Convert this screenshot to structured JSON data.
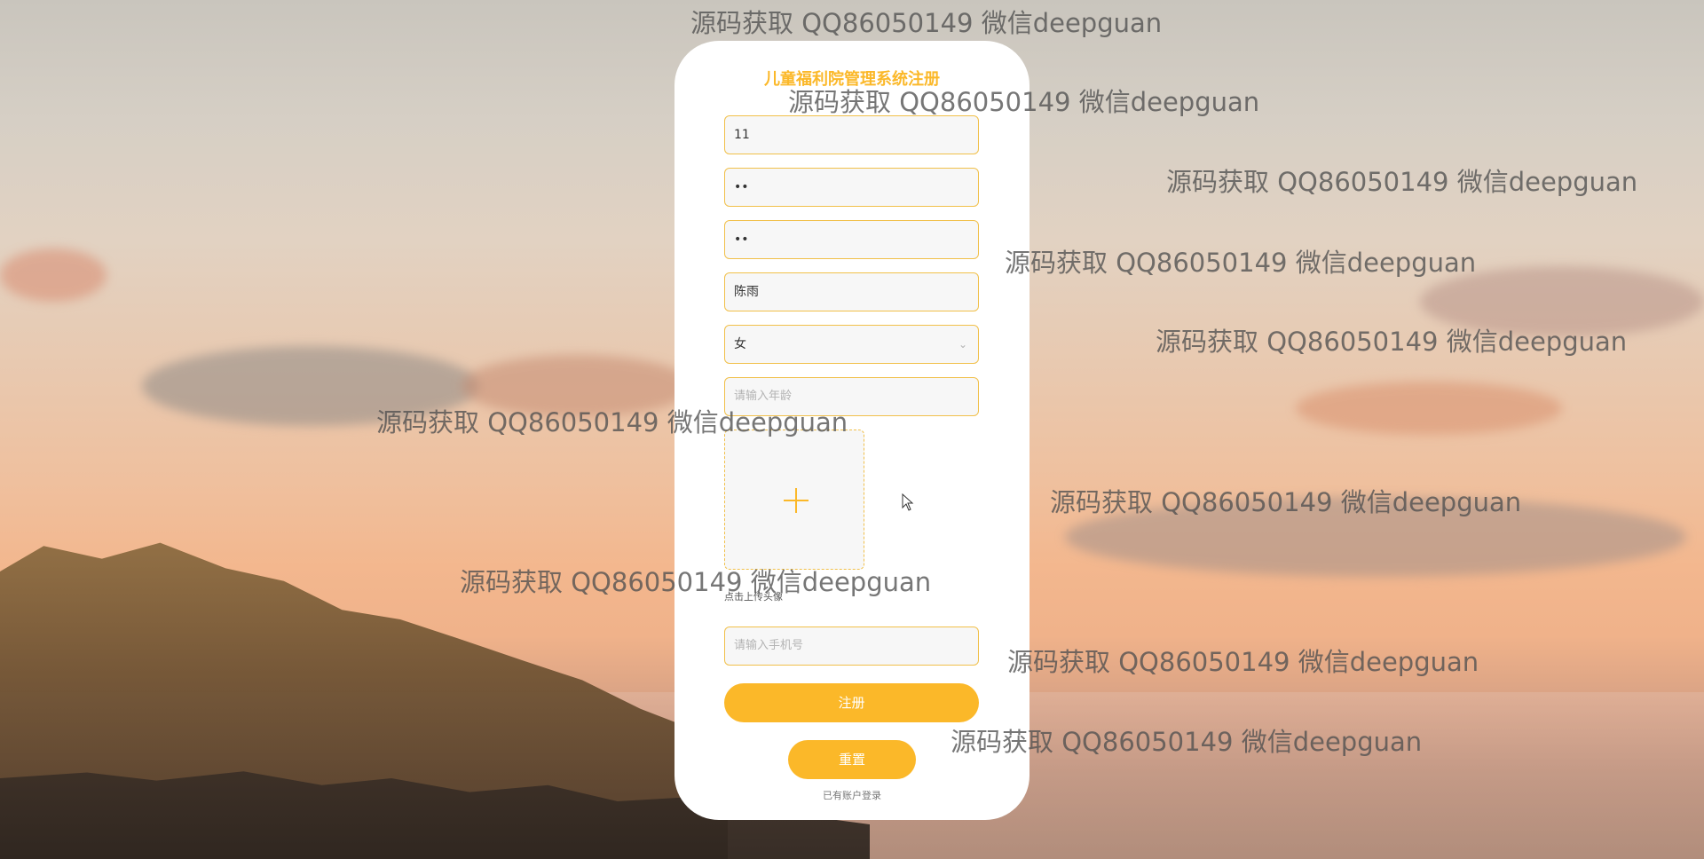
{
  "form": {
    "title": "儿童福利院管理系统注册",
    "fields": {
      "account_value": "11",
      "password_value": "••",
      "confirm_password_value": "••",
      "name_value": "陈雨",
      "gender_value": "女",
      "age_placeholder": "请输入年龄",
      "phone_placeholder": "请输入手机号"
    },
    "upload_hint": "点击上传头像",
    "register_label": "注册",
    "reset_label": "重置",
    "login_link": "已有账户登录"
  },
  "watermark": {
    "text": "源码获取 QQ86050149 微信deepguan"
  },
  "icons": {
    "upload": "plus-icon",
    "select": "chevron-down-icon",
    "cursor": "mouse-pointer-icon"
  },
  "colors": {
    "accent": "#fbb829",
    "field_border": "#f1c04a",
    "field_bg": "#f7f7f7",
    "card_bg": "#ffffff"
  }
}
